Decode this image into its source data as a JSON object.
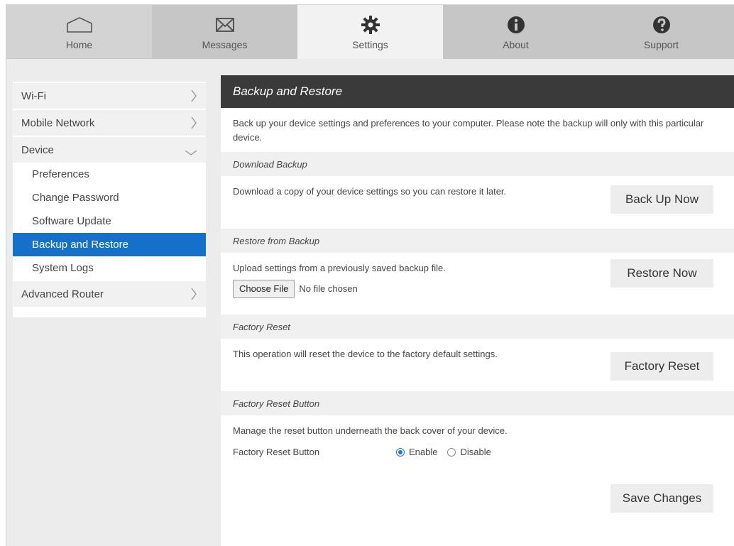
{
  "nav": {
    "home": "Home",
    "messages": "Messages",
    "settings": "Settings",
    "about": "About",
    "support": "Support"
  },
  "sidebar": {
    "wifi": "Wi-Fi",
    "mobile_network": "Mobile Network",
    "device": "Device",
    "sub": [
      "Preferences",
      "Change Password",
      "Software Update",
      "Backup and Restore",
      "System Logs"
    ],
    "advanced_router": "Advanced Router"
  },
  "main": {
    "title": "Backup and Restore",
    "intro": "Back up your device settings and preferences to your computer. Please note the backup will only with this particular device.",
    "download": {
      "header": "Download Backup",
      "text": "Download a copy of your device settings so you can restore it later.",
      "button": "Back Up Now"
    },
    "restore": {
      "header": "Restore from Backup",
      "text": "Upload settings from a previously saved backup file.",
      "choose_button": "Choose File",
      "file_status": "No file chosen",
      "button": "Restore Now"
    },
    "factory": {
      "header": "Factory Reset",
      "text": "This operation will reset the device to the factory default settings.",
      "button": "Factory Reset"
    },
    "reset_button": {
      "header": "Factory Reset Button",
      "text": "Manage the reset button underneath the back cover of your device.",
      "label": "Factory Reset Button",
      "enable": "Enable",
      "disable": "Disable",
      "selected": "Enable",
      "save": "Save Changes"
    }
  },
  "colors": {
    "accent": "#1570c9",
    "header_bg": "#3a3a3a"
  }
}
